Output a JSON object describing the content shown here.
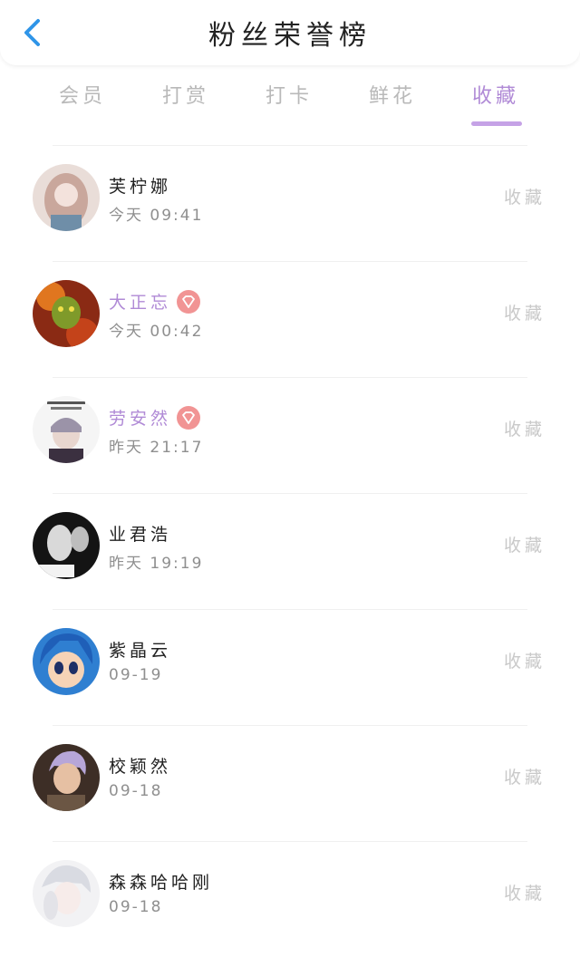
{
  "header": {
    "title": "粉丝荣誉榜",
    "back_icon": "chevron-left-icon"
  },
  "tabs": [
    {
      "label": "会员",
      "active": false
    },
    {
      "label": "打赏",
      "active": false
    },
    {
      "label": "打卡",
      "active": false
    },
    {
      "label": "鲜花",
      "active": false
    },
    {
      "label": "收藏",
      "active": true
    }
  ],
  "colors": {
    "accent": "#b08ad6",
    "back": "#2f95e8",
    "badge": "#f19494"
  },
  "fans": [
    {
      "name": "芙柠娜",
      "time": "今天 09:41",
      "vip": false,
      "action": "收藏"
    },
    {
      "name": "大正忘",
      "time": "今天 00:42",
      "vip": true,
      "action": "收藏"
    },
    {
      "name": "劳安然",
      "time": "昨天 21:17",
      "vip": true,
      "action": "收藏"
    },
    {
      "name": "业君浩",
      "time": "昨天 19:19",
      "vip": false,
      "action": "收藏"
    },
    {
      "name": "紫晶云",
      "time": "09-19",
      "vip": false,
      "action": "收藏"
    },
    {
      "name": "校颖然",
      "time": "09-18",
      "vip": false,
      "action": "收藏"
    },
    {
      "name": "森森哈哈刚",
      "time": "09-18",
      "vip": false,
      "action": "收藏"
    }
  ]
}
